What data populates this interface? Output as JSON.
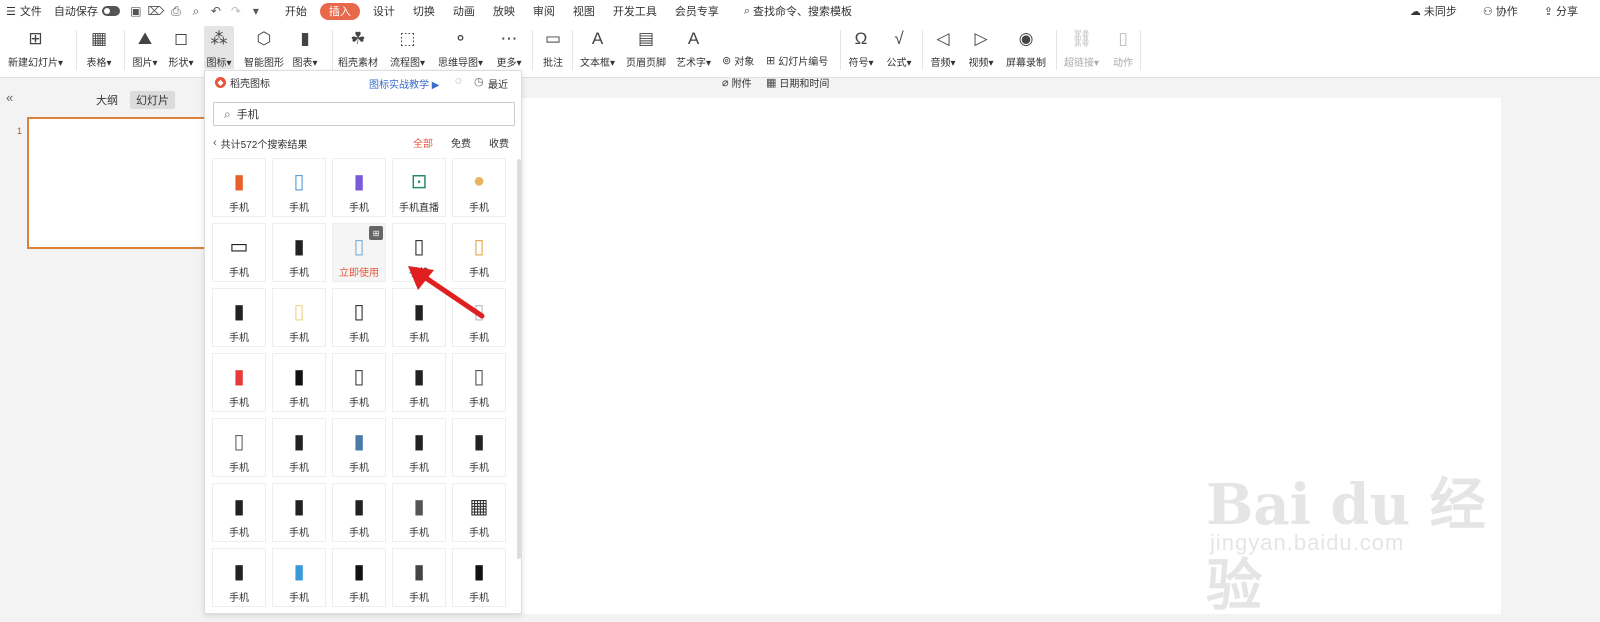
{
  "menu": {
    "file": "文件",
    "autosave": "自动保存",
    "tabs": [
      "开始",
      "插入",
      "设计",
      "切换",
      "动画",
      "放映",
      "审阅",
      "视图",
      "开发工具",
      "会员专享"
    ],
    "active_tab": "插入",
    "search_placeholder": "查找命令、搜索模板",
    "sync": "未同步",
    "collab": "协作",
    "share": "分享"
  },
  "ribbon": {
    "new_slide": "新建幻灯片",
    "table": "表格",
    "picture": "图片",
    "shape": "形状",
    "icon": "图标",
    "smart_shape": "智能图形",
    "chart": "图表",
    "material": "稻壳素材",
    "flowchart": "流程图",
    "mindmap": "思维导图",
    "more": "更多",
    "comment": "批注",
    "textbox": "文本框",
    "header_footer": "页眉页脚",
    "wordart": "艺术字",
    "object": "对象",
    "attachment": "附件",
    "slide_number": "幻灯片编号",
    "datetime": "日期和时间",
    "symbol": "符号",
    "formula": "公式",
    "audio": "音频",
    "video": "视频",
    "screen_record": "屏幕录制",
    "hyperlink": "超链接",
    "action": "动作"
  },
  "left_pane": {
    "outline_tab": "大纲",
    "slides_tab": "幻灯片",
    "slide_number": "1"
  },
  "icon_panel": {
    "title": "稻壳图标",
    "tutorial": "图标实战教学",
    "recent": "最近",
    "search_value": "手机",
    "result_count": "共计572个搜索结果",
    "filters": [
      "全部",
      "免费",
      "收费"
    ],
    "active_filter": "全部",
    "hover_label": "立即使用",
    "items": [
      {
        "label": "手机",
        "icon": "phone-orange-icon",
        "color": "#e8602a"
      },
      {
        "label": "手机",
        "icon": "phone-heart-icon",
        "color": "#5b9bd5"
      },
      {
        "label": "手机",
        "icon": "phone-purple-icon",
        "color": "#7a5bd9"
      },
      {
        "label": "手机直播",
        "icon": "phone-livestream-icon",
        "color": "#2a8a6a"
      },
      {
        "label": "手机",
        "icon": "phone-gold-icon",
        "color": "#e6b45c"
      },
      {
        "label": "手机",
        "icon": "phone-landscape-icon",
        "color": "#222222"
      },
      {
        "label": "手机",
        "icon": "phone-keypad-icon",
        "color": "#222222"
      },
      {
        "label": "手机",
        "icon": "phone-sketch-icon",
        "color": "#7fb0d8"
      },
      {
        "label": "手机",
        "icon": "phone-cart-icon",
        "color": "#333333"
      },
      {
        "label": "手机",
        "icon": "phone-colorful-icon",
        "color": "#e8a84a"
      },
      {
        "label": "手机",
        "icon": "phone-black-icon",
        "color": "#222222"
      },
      {
        "label": "手机",
        "icon": "phone-yellow-icon",
        "color": "#f2d48a"
      },
      {
        "label": "手机",
        "icon": "phone-outline-icon",
        "color": "#333333"
      },
      {
        "label": "手机",
        "icon": "phone-classic-icon",
        "color": "#222222"
      },
      {
        "label": "手机",
        "icon": "phone-light-icon",
        "color": "#bbbbbb"
      },
      {
        "label": "手机",
        "icon": "phone-red-dot-icon",
        "color": "#e83a3a"
      },
      {
        "label": "手机",
        "icon": "phone-solid-icon",
        "color": "#111111"
      },
      {
        "label": "手机",
        "icon": "phone-thin-icon",
        "color": "#444444"
      },
      {
        "label": "手机",
        "icon": "phone-antenna-icon",
        "color": "#222222"
      },
      {
        "label": "手机",
        "icon": "tablet-outline-icon",
        "color": "#555555"
      },
      {
        "label": "手机",
        "icon": "phone-small-icon",
        "color": "#666666"
      },
      {
        "label": "手机",
        "icon": "phone-flip-icon",
        "color": "#222222"
      },
      {
        "label": "手机",
        "icon": "phone-blue-screen-icon",
        "color": "#4a7aa8"
      },
      {
        "label": "手机",
        "icon": "phone-rounded-icon",
        "color": "#222222"
      },
      {
        "label": "手机",
        "icon": "phone-side-icon",
        "color": "#222222"
      },
      {
        "label": "手机",
        "icon": "phone-dock-icon",
        "color": "#222222"
      },
      {
        "label": "手机",
        "icon": "phone-bar-icon",
        "color": "#222222"
      },
      {
        "label": "手机",
        "icon": "phone-angled-icon",
        "color": "#222222"
      },
      {
        "label": "手机",
        "icon": "phone-grey-icon",
        "color": "#555555"
      },
      {
        "label": "手机",
        "icon": "phone-grid-icon",
        "color": "#333333"
      },
      {
        "label": "手机",
        "icon": "phone-old-icon",
        "color": "#222222"
      },
      {
        "label": "手机",
        "icon": "phone-teal-icon",
        "color": "#3a9ad9"
      },
      {
        "label": "手机",
        "icon": "phone-call-icon",
        "color": "#111111"
      },
      {
        "label": "手机",
        "icon": "phone-feature-icon",
        "color": "#444444"
      },
      {
        "label": "手机",
        "icon": "phone-modern-icon",
        "color": "#111111"
      }
    ]
  },
  "watermark": {
    "logo_text": "Bai du 经验",
    "url": "jingyan.baidu.com"
  },
  "accent_color": "#e8684a"
}
